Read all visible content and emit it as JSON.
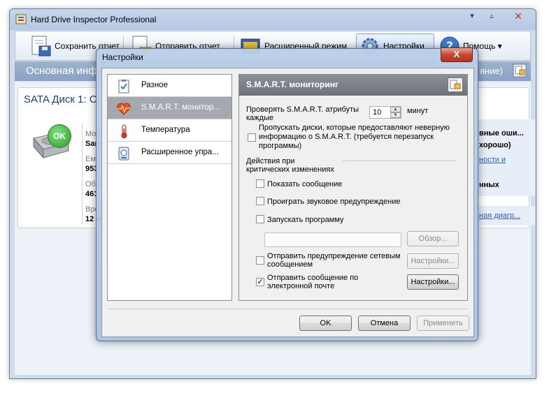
{
  "app": {
    "title": "Hard Drive Inspector Professional",
    "win_min": "▾",
    "win_max": "▵",
    "win_close": "✕"
  },
  "toolbar": {
    "save_report": "Сохранить отчет",
    "send_report": "Отправить отчет",
    "advanced_mode": "Расширенный режим",
    "settings": "Настройки",
    "help": "Помощь ▾"
  },
  "info_header": {
    "title": "Основная инф",
    "right_text": "яние)"
  },
  "disk_panel": {
    "title": "SATA Диск 1: С",
    "status_badge": "OK",
    "fields": [
      {
        "label": "Мод",
        "value": "Sam"
      },
      {
        "label": "Емк",
        "value": "953"
      },
      {
        "label": "Общ",
        "value": "461"
      },
      {
        "label": "Врем",
        "value": "12 м"
      }
    ],
    "right_lines": [
      "вные оши...",
      "хорошо)",
      "ности и",
      "нных"
    ],
    "right_link": "ная диагр..."
  },
  "dialog": {
    "title": "Настройки",
    "close_label": "X",
    "nav": [
      {
        "label": "Разное",
        "icon": "clipboard-check-icon"
      },
      {
        "label": "S.M.A.R.T. монитор...",
        "icon": "heart-monitor-icon"
      },
      {
        "label": "Температура",
        "icon": "thermometer-icon"
      },
      {
        "label": "Расширенное упра...",
        "icon": "drive-settings-icon"
      }
    ],
    "page": {
      "title": "S.M.A.R.T. мониторинг",
      "check_label_1": "Проверять S.M.A.R.T. атрибуты",
      "check_label_2": "каждые",
      "interval_value": "10",
      "interval_unit": "минут",
      "skip_disks_1": "Пропускать диски, которые предоставляют неверную",
      "skip_disks_2": "информацию о S.M.A.R.T. (требуется перезапуск",
      "skip_disks_3": "программы)",
      "actions_1": "Действия при",
      "actions_2": "критических изменениях",
      "show_message": "Показать сообщение",
      "play_sound": "Проиграть звуковое предупреждение",
      "run_program": "Запускать программу",
      "program_path": "",
      "browse": "Обзор...",
      "net_warning_1": "Отправить предупреждение сетевым",
      "net_warning_2": "сообщением",
      "net_settings": "Настройки...",
      "email_1": "Отправить сообщение по",
      "email_2": "электронной почте",
      "email_settings": "Настройки...",
      "checks": {
        "skip_disks": false,
        "show_message": false,
        "play_sound": false,
        "run_program": false,
        "net_warning": false,
        "email": true
      }
    },
    "buttons": {
      "ok": "OK",
      "cancel": "Отмена",
      "apply": "Применить"
    }
  }
}
